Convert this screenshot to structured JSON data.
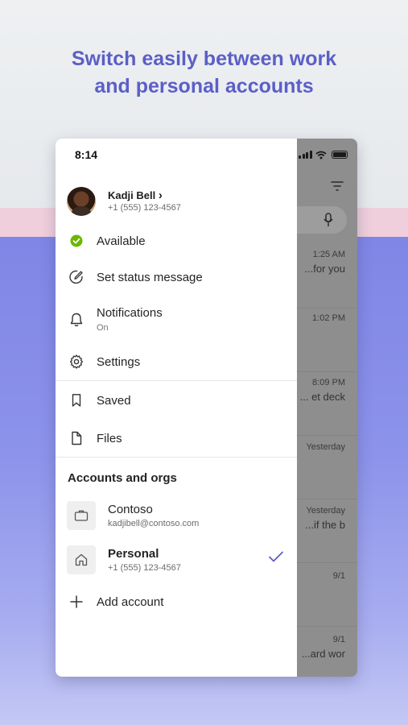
{
  "headline": {
    "line1": "Switch easily between work",
    "line2": "and personal accounts"
  },
  "status_bar": {
    "time": "8:14"
  },
  "profile": {
    "name": "Kadji Bell",
    "chevron": "›",
    "phone": "+1 (555) 123-4567"
  },
  "menu": {
    "available": "Available",
    "set_status": "Set status message",
    "notifications": "Notifications",
    "notifications_state": "On",
    "settings": "Settings",
    "saved": "Saved",
    "files": "Files"
  },
  "accounts": {
    "title": "Accounts and orgs",
    "items": [
      {
        "name": "Contoso",
        "detail": "kadjibell@contoso.com",
        "icon": "briefcase-icon",
        "selected": false
      },
      {
        "name": "Personal",
        "detail": "+1 (555) 123-4567",
        "icon": "home-icon",
        "selected": true
      }
    ],
    "add": "Add account"
  },
  "chat_list": [
    {
      "time": "1:25 AM",
      "snippet": "for you..."
    },
    {
      "time": "1:02 PM",
      "snippet": ""
    },
    {
      "time": "8:09 PM",
      "snippet": "et deck ..."
    },
    {
      "time": "Yesterday",
      "snippet": ""
    },
    {
      "time": "Yesterday",
      "snippet": "if the b..."
    },
    {
      "time": "9/1",
      "snippet": ""
    },
    {
      "time": "9/1",
      "snippet": "ard wor..."
    }
  ],
  "colors": {
    "brand": "#5b5fc7",
    "available_green": "#6bb700",
    "check": "#5b5fc7"
  }
}
